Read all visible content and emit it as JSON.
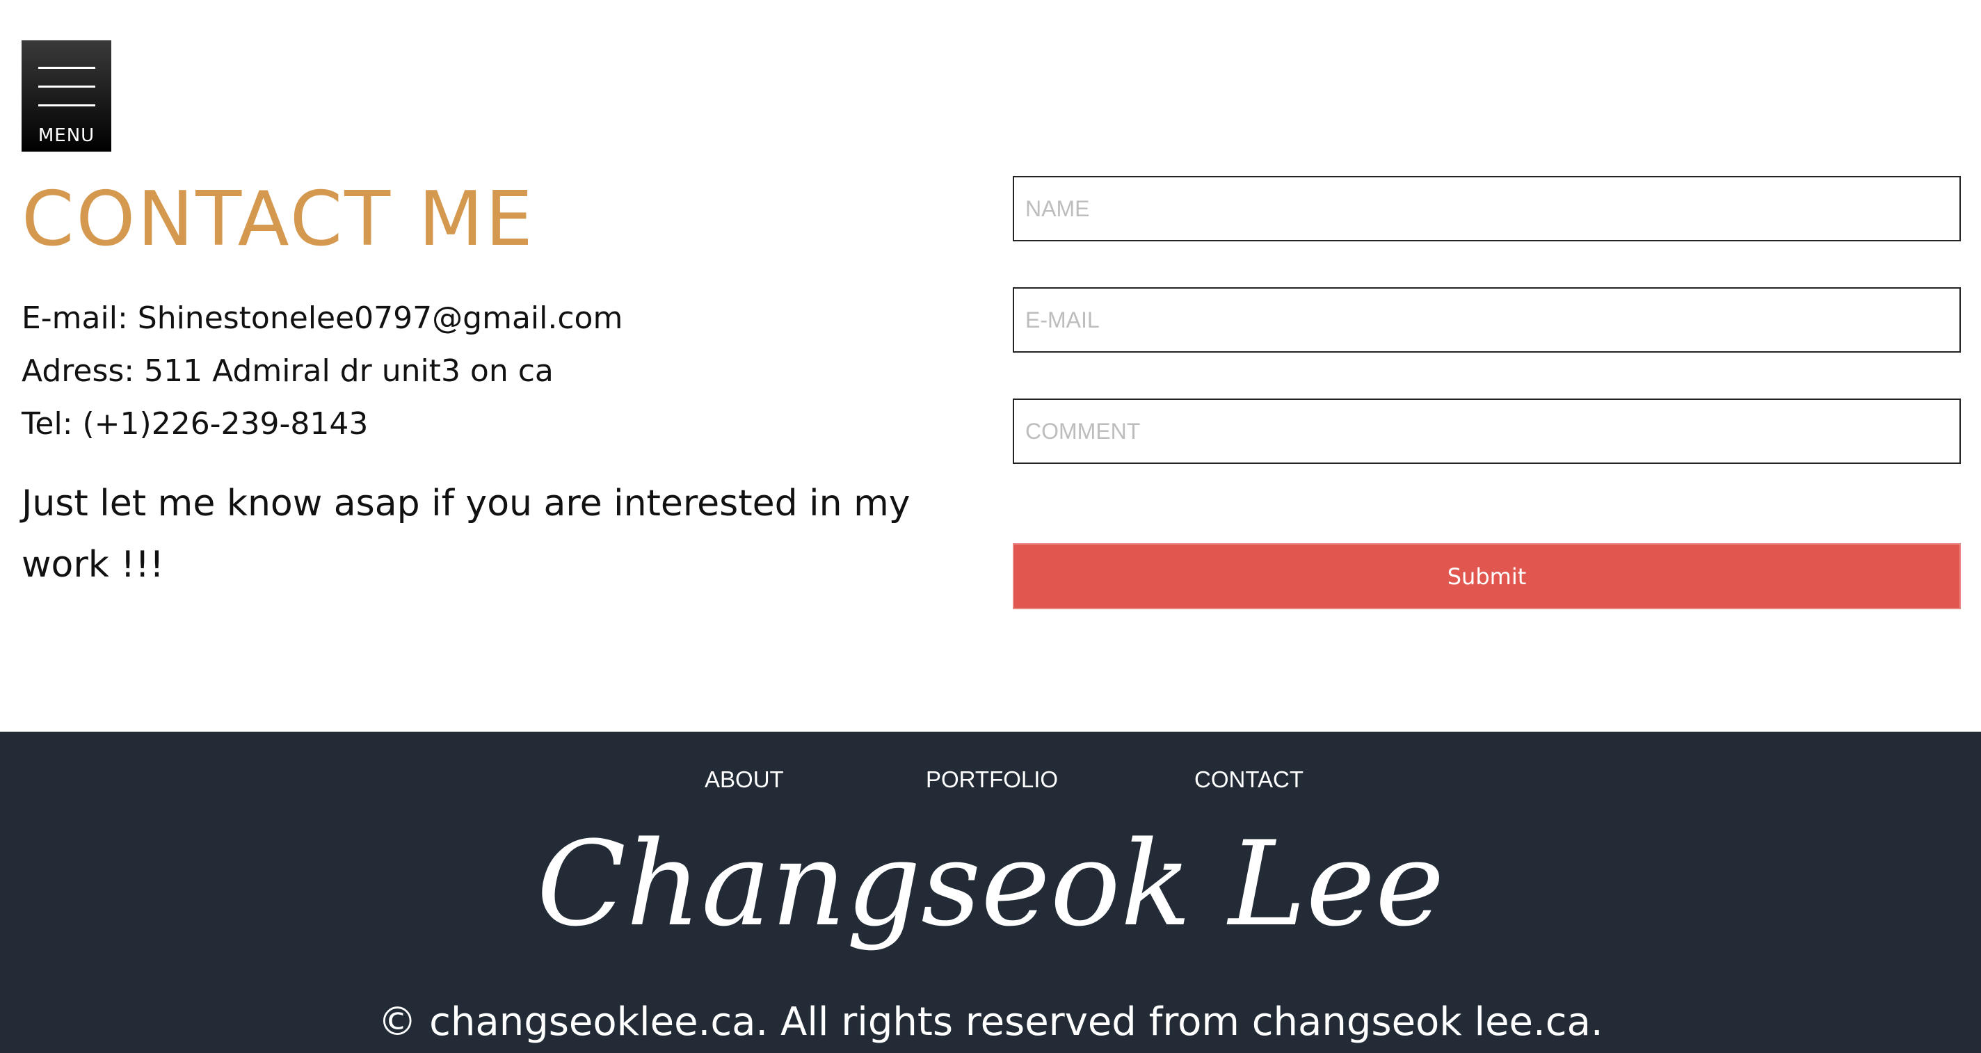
{
  "menu": {
    "label": "MENU",
    "icon": "hamburger-icon"
  },
  "contact": {
    "title": "CONTACT ME",
    "email_line": "E-mail: Shinestonelee0797@gmail.com",
    "address_line": "Adress: 511 Admiral dr unit3 on ca",
    "tel_line": "Tel: (+1)226-239-8143",
    "message": "Just let me know asap if you are interested in my work !!!"
  },
  "form": {
    "name_placeholder": "NAME",
    "email_placeholder": "E-MAIL",
    "comment_placeholder": "COMMENT",
    "submit_label": "Submit"
  },
  "footer": {
    "nav": {
      "about": "ABOUT",
      "portfolio": "PORTFOLIO",
      "contact": "CONTACT"
    },
    "logo_text": "Changseok Lee",
    "copyright": "© changseoklee.ca. All rights reserved from changseok lee.ca."
  },
  "colors": {
    "title_accent": "#d4984f",
    "submit_button": "#e25650",
    "footer_background": "#222b36"
  }
}
